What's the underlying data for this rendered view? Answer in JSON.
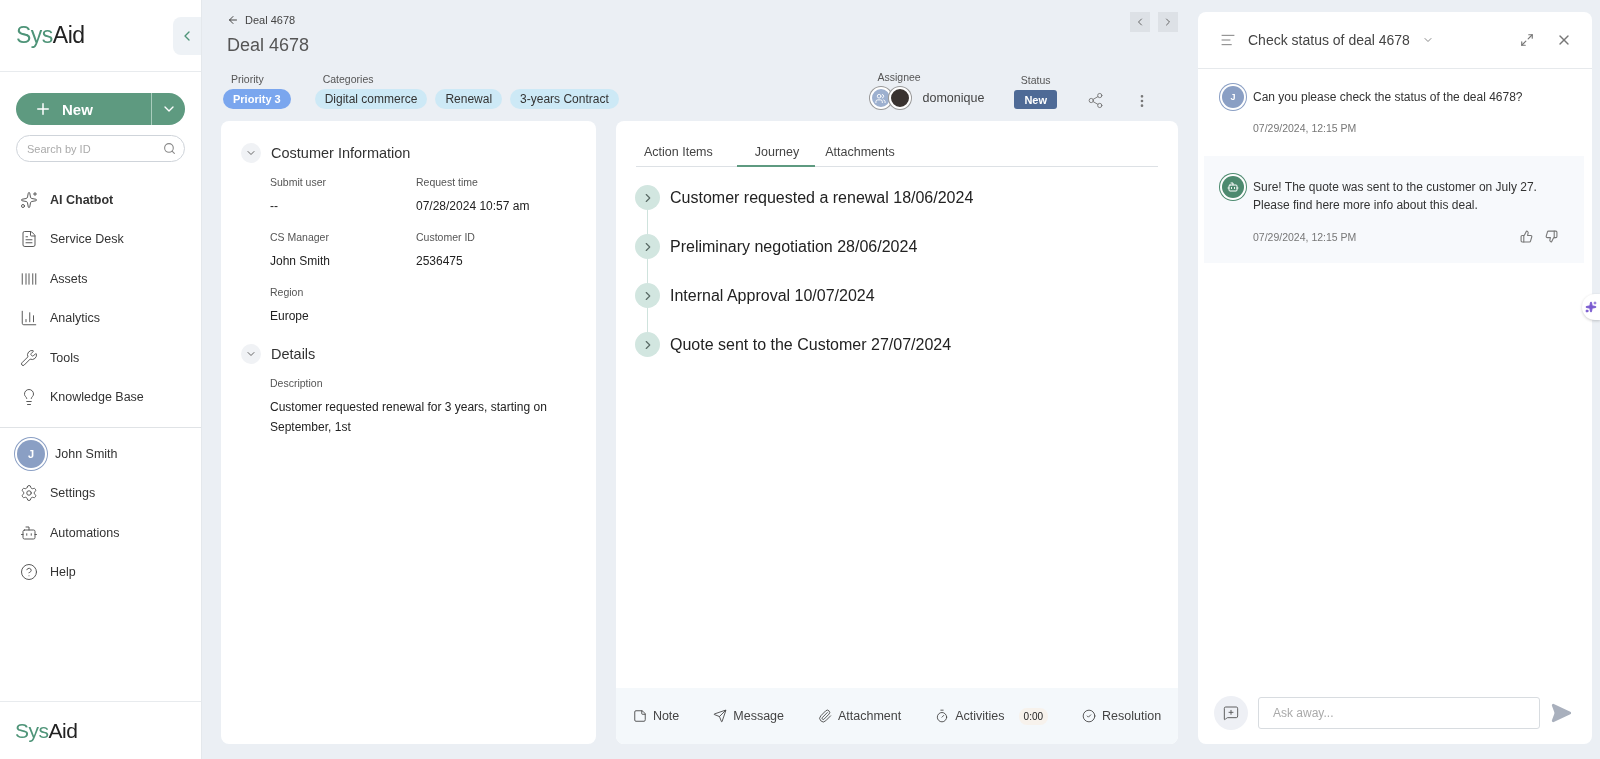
{
  "sidebar": {
    "logo": {
      "first": "Sys",
      "second": "Aid"
    },
    "new_button": "New",
    "search": {
      "placeholder": "Search by ID"
    },
    "items": [
      {
        "label": "AI Chatbot",
        "selected": true
      },
      {
        "label": "Service Desk",
        "selected": false
      },
      {
        "label": "Assets",
        "selected": false
      },
      {
        "label": "Analytics",
        "selected": false
      },
      {
        "label": "Tools",
        "selected": false
      },
      {
        "label": "Knowledge Base",
        "selected": false
      }
    ],
    "bottom_items": [
      {
        "kind": "user",
        "label": "John Smith",
        "initial": "J"
      },
      {
        "kind": "link",
        "label": "Settings"
      },
      {
        "kind": "link",
        "label": "Automations"
      },
      {
        "kind": "link",
        "label": "Help"
      }
    ],
    "footer_logo": {
      "first": "Sys",
      "second": "Aid"
    }
  },
  "header": {
    "back": "Deal 4678",
    "title": "Deal 4678",
    "priority": {
      "label": "Priority",
      "value": "Priority 3"
    },
    "categories": {
      "label": "Categories",
      "tags": [
        "Digital commerce",
        "Renewal",
        "3-years Contract"
      ]
    },
    "assignee": {
      "label": "Assignee",
      "name": "domonique"
    },
    "status": {
      "label": "Status",
      "value": "New"
    }
  },
  "info_card": {
    "sections": [
      {
        "title": "Costumer Information",
        "expanded": true,
        "fields": [
          {
            "label": "Submit user",
            "value": "--"
          },
          {
            "label": "Request time",
            "value": "07/28/2024 10:57 am"
          },
          {
            "label": "CS Manager",
            "value": "John Smith"
          },
          {
            "label": "Customer ID",
            "value": "2536475"
          },
          {
            "label": "Region",
            "value": "Europe"
          }
        ]
      },
      {
        "title": "Details",
        "expanded": true,
        "fields": [
          {
            "label": "Description",
            "value": "Customer requested renewal for 3 years, starting on September, 1st"
          }
        ]
      }
    ]
  },
  "journey_card": {
    "tabs": [
      {
        "label": "Action Items",
        "selected": false
      },
      {
        "label": "Journey",
        "selected": true
      },
      {
        "label": "Attachments",
        "selected": false
      }
    ],
    "steps": [
      "Customer requested a renewal 18/06/2024",
      "Preliminary negotiation 28/06/2024",
      "Internal Approval 10/07/2024",
      "Quote sent to the Customer 27/07/2024"
    ],
    "actions": [
      {
        "label": "Note"
      },
      {
        "label": "Message"
      },
      {
        "label": "Attachment"
      },
      {
        "label": "Activities",
        "badge": "0:00"
      },
      {
        "label": "Resolution"
      }
    ]
  },
  "chat": {
    "title": "Check status of deal 4678",
    "messages": [
      {
        "kind": "user",
        "initial": "J",
        "text": "Can you please check the status of the deal 4678?",
        "time": "07/29/2024, 12:15 PM"
      },
      {
        "kind": "bot",
        "text": "Sure! The quote was sent to the customer on July 27. Please find here more info about this deal.",
        "time": "07/29/2024, 12:15 PM"
      }
    ],
    "input": {
      "placeholder": "Ask away..."
    }
  }
}
